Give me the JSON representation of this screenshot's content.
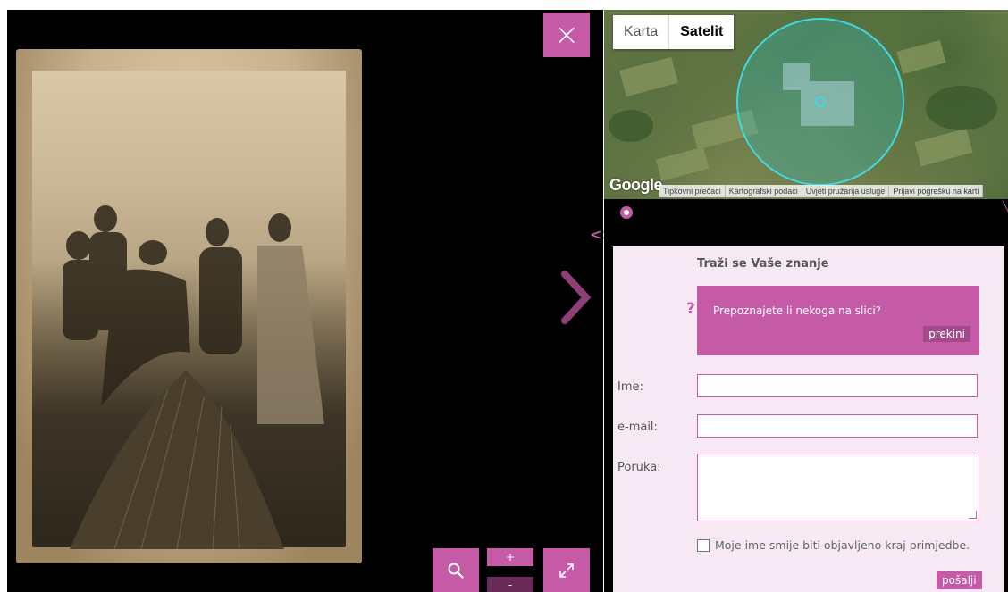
{
  "viewer": {
    "close_icon": "×",
    "next_icon": "chevron-right-icon",
    "search_icon": "magnifier-icon",
    "zoom_in_label": "+",
    "zoom_out_label": "-",
    "fullscreen_icon": "expand-icon"
  },
  "map": {
    "tabs": [
      {
        "label": "Karta"
      },
      {
        "label": "Satelit"
      }
    ],
    "logo": "Google",
    "attribution": [
      "Tipkovni prečaci",
      "Kartografski podaci",
      "Uvjeti pružanja usluge",
      "Prijavi pogrešku na karti"
    ]
  },
  "toggle_arrows": "<>",
  "form": {
    "title": "Traži se Vaše znanje",
    "question_mark": "?",
    "prompt": "Prepoznajete li nekoga na slici?",
    "cancel_label": "prekini",
    "name_label": "Ime:",
    "email_label": "e-mail:",
    "message_label": "Poruka:",
    "consent_label": "Moje ime smije biti objavljeno kraj primjedbe.",
    "send_label": "pošalji"
  },
  "colors": {
    "accent": "#c55aa6",
    "accent_dark": "#6a2b58",
    "form_bg": "#f6e9f4"
  }
}
